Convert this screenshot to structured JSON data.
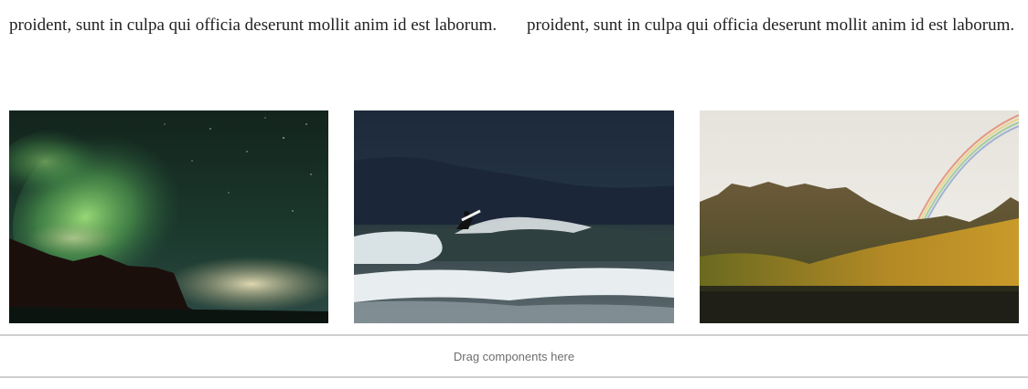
{
  "text_columns": {
    "left": {
      "paragraph": "proident, sunt in culpa qui officia deserunt mollit anim id est laborum."
    },
    "right": {
      "paragraph": "proident, sunt in culpa qui officia deserunt mollit anim id est laborum."
    }
  },
  "images": [
    {
      "subject": "aurora-over-mountains"
    },
    {
      "subject": "surfer-on-wave"
    },
    {
      "subject": "rainbow-over-mountain-lake"
    }
  ],
  "dropzone": {
    "label": "Drag components here",
    "border_color": "#cfcfcf"
  }
}
